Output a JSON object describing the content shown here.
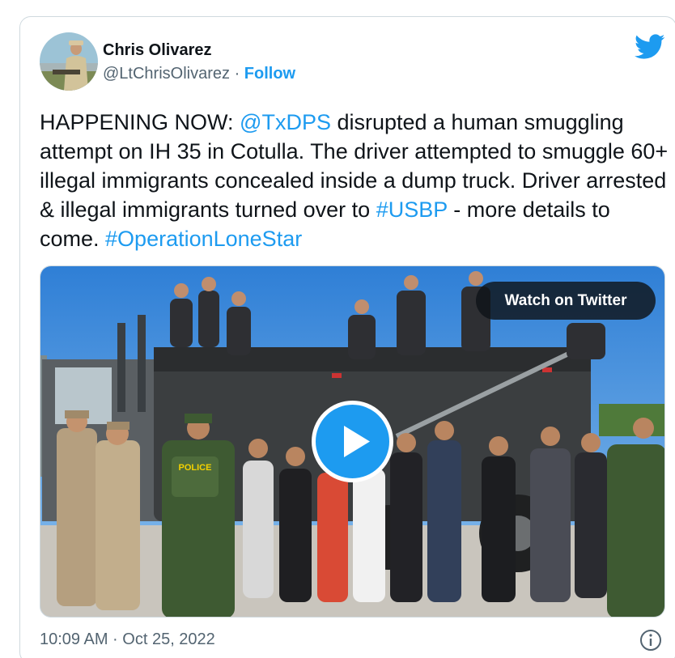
{
  "author": {
    "name": "Chris Olivarez",
    "handle": "@LtChrisOlivarez",
    "separator": " · ",
    "follow_label": "Follow"
  },
  "brand": {
    "icon": "twitter-bird-icon",
    "color": "#1d9bf0"
  },
  "tweet": {
    "part1": "HAPPENING NOW: ",
    "mention": "@TxDPS",
    "part2": " disrupted a human smuggling attempt on IH 35 in Cotulla. The driver attempted to smuggle 60+ illegal immigrants concealed inside a dump truck. Driver arrested & illegal immigrants turned over to ",
    "hashtag1": "#USBP",
    "part3": " - more details to come. ",
    "hashtag2": "#OperationLoneStar"
  },
  "media": {
    "watch_label": "Watch on Twitter",
    "play_icon": "play-icon",
    "police_patch": "POLICE"
  },
  "footer": {
    "timestamp": "10:09 AM · Oct 25, 2022",
    "info_icon": "info-icon"
  }
}
